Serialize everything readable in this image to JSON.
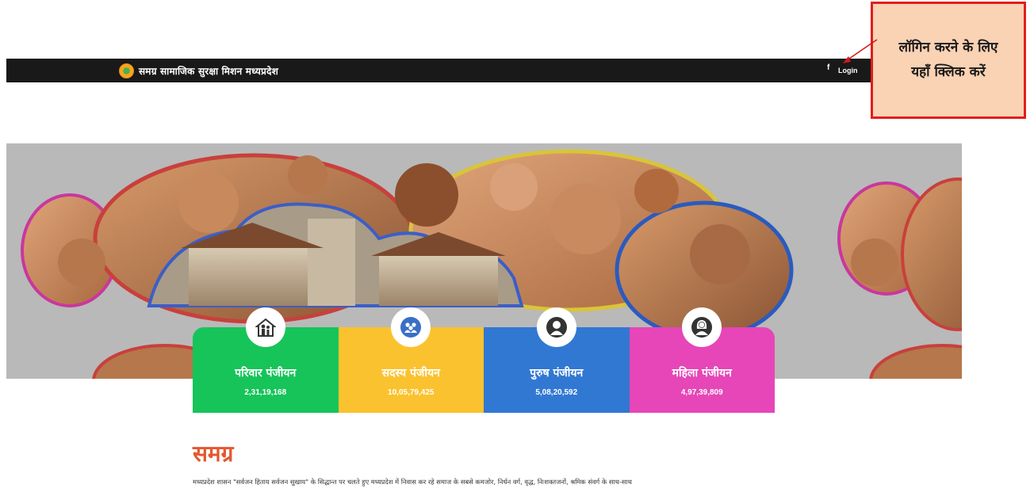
{
  "header": {
    "brand_title": "समग्र सामाजिक सुरक्षा मिशन मध्यप्रदेश",
    "facebook_glyph": "f",
    "login_label": "Login"
  },
  "annotation": {
    "text": "लॉगिन करने के लिए यहाँ क्लिक करें",
    "border_color": "#e01e1e",
    "background_color": "#fad2b4"
  },
  "stats": [
    {
      "label": "परिवार पंजीयन",
      "count": "2,31,19,168",
      "color": "#16c45a",
      "icon": "family-house-icon"
    },
    {
      "label": "सदस्य पंजीयन",
      "count": "10,05,79,425",
      "color": "#fbc22f",
      "icon": "group-members-icon"
    },
    {
      "label": "पुरुष पंजीयन",
      "count": "5,08,20,592",
      "color": "#3178d3",
      "icon": "male-user-icon"
    },
    {
      "label": "महिला पंजीयन",
      "count": "4,97,39,809",
      "color": "#e646b8",
      "icon": "female-user-icon"
    }
  ],
  "about": {
    "title": "समग्र",
    "description": "मध्यप्रदेश शासन \"सर्वजन हिताय सर्वजन सुखाय\" के सिद्धान्त पर चलते हुए मध्यप्रदेश में निवास कर रहे समाज के सबसे कमजोर, निर्धन वर्ग, वृद्ध, निःशक्तजनों, श्रमिक संवर्ग के साथ-साथ"
  },
  "colors": {
    "topbar": "#191919",
    "title_accent": "#e4572e"
  }
}
